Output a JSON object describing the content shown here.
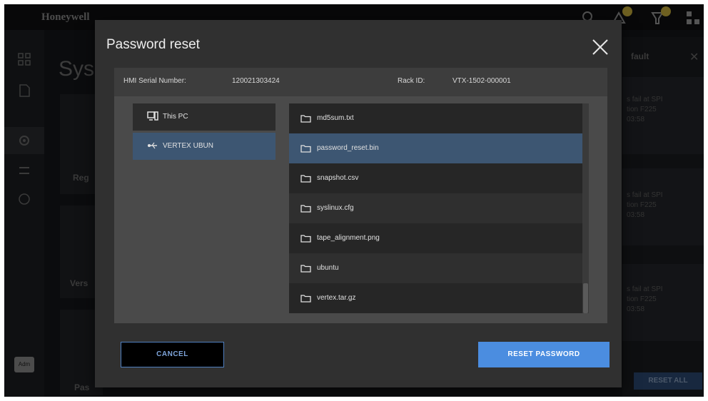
{
  "app": {
    "brand": "Honeywell",
    "page_title": "Sys",
    "bg_labels": [
      "Reg",
      "Vers",
      "Pas"
    ],
    "admin_label": "Adm"
  },
  "right_panel": {
    "title": "fault",
    "cards": [
      {
        "line1": "s fail at SPI",
        "line2": "tion      F225",
        "line3": "03:58"
      },
      {
        "line1": "s fail at SPI",
        "line2": "tion      F225",
        "line3": "03:58"
      },
      {
        "line1": "s fail at SPI",
        "line2": "tion      F225",
        "line3": "03:58"
      }
    ],
    "reset_all_label": "RESET ALL"
  },
  "modal": {
    "title": "Password reset",
    "serial_label": "HMI Serial Number:",
    "serial_value": "120021303424",
    "rack_label": "Rack ID:",
    "rack_value": "VTX-1502-000001",
    "locations": [
      {
        "label": "This PC",
        "icon": "computer-icon",
        "selected": false
      },
      {
        "label": "VERTEX UBUN",
        "icon": "usb-icon",
        "selected": true
      }
    ],
    "files": [
      {
        "name": "md5sum.txt",
        "icon": "folder-icon",
        "selected": false
      },
      {
        "name": "password_reset.bin",
        "icon": "folder-icon",
        "selected": true
      },
      {
        "name": "snapshot.csv",
        "icon": "folder-icon",
        "selected": false
      },
      {
        "name": "syslinux.cfg",
        "icon": "folder-icon",
        "selected": false
      },
      {
        "name": "tape_alignment.png",
        "icon": "folder-icon",
        "selected": false
      },
      {
        "name": "ubuntu",
        "icon": "folder-icon",
        "selected": false
      },
      {
        "name": "vertex.tar.gz",
        "icon": "folder-icon",
        "selected": false
      }
    ],
    "cancel_label": "CANCEL",
    "reset_label": "RESET PASSWORD"
  },
  "colors": {
    "accent": "#4b8de0",
    "selected_row": "#3d5672",
    "modal_bg": "#303030",
    "badge": "#c8b03c"
  }
}
